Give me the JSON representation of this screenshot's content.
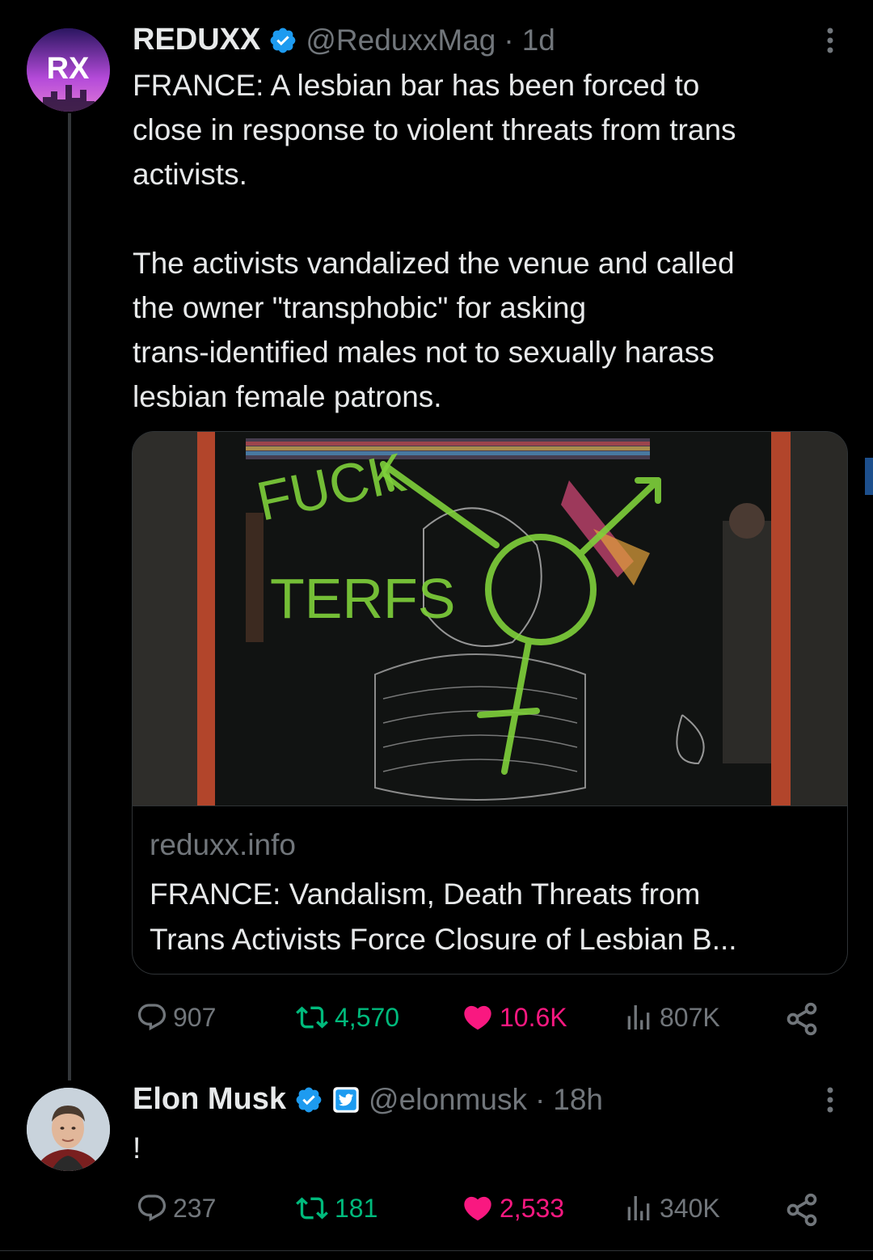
{
  "tweet1": {
    "name": "REDUXX",
    "handle": "@ReduxxMag",
    "dot": "·",
    "time": "1d",
    "avatar_text": "RX",
    "text_p1": [
      "FRANCE: A lesbian bar has been forced to",
      "close in response to violent threats from trans",
      "activists."
    ],
    "text_p2": [
      "The activists vandalized the venue and called",
      "the owner \"transphobic\" for asking",
      "trans-identified males not to sexually harass",
      "lesbian female patrons."
    ],
    "card": {
      "domain": "reduxx.info",
      "title_lines": [
        "FRANCE: Vandalism, Death Threats from",
        "Trans Activists Force Closure of Lesbian B..."
      ],
      "graffiti_1": "FUCK",
      "graffiti_2": "TERFS"
    },
    "actions": {
      "replies": "907",
      "retweets": "4,570",
      "likes": "10.6K",
      "views": "807K"
    }
  },
  "tweet2": {
    "name": "Elon Musk",
    "handle": "@elonmusk",
    "dot": "·",
    "time": "18h",
    "text": "!",
    "actions": {
      "replies": "237",
      "retweets": "181",
      "likes": "2,533",
      "views": "340K"
    }
  },
  "colors": {
    "verified": "#1d9bf0",
    "like": "#f91880",
    "retweet": "#00ba7c",
    "muted": "#71767b",
    "graffiti": "#7fd13b"
  },
  "icons": [
    "verified-badge-icon",
    "more-icon",
    "reply-icon",
    "retweet-icon",
    "like-icon",
    "views-icon",
    "share-icon",
    "government-badge-icon"
  ]
}
